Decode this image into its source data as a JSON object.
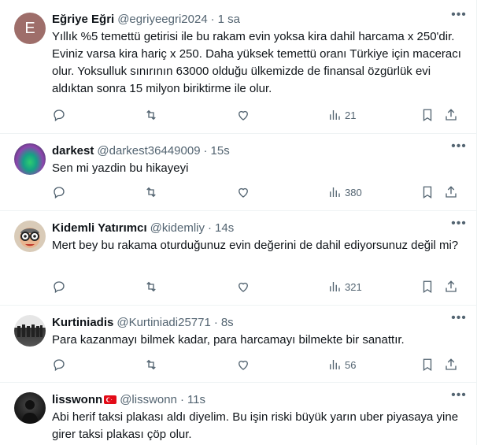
{
  "tweets": [
    {
      "name": "Eğriye Eğri",
      "handle": "@egriyeegri2024",
      "time": "1 sa",
      "avatar_letter": "E",
      "text": "Yıllık %5 temettü getirisi ile bu rakam evin yoksa kira dahil harcama x 250'dir. Eviniz varsa kira hariç x 250. Daha yüksek temettü oranı Türkiye için maceracı olur. Yoksulluk sınırının 63000 olduğu ülkemizde de finansal özgürlük evi aldıktan sonra 15 milyon biriktirme ile olur.",
      "views": "21"
    },
    {
      "name": "darkest",
      "handle": "@darkest36449009",
      "time": "15s",
      "text": "Sen mi yazdin bu hikayeyi",
      "views": "380"
    },
    {
      "name": "Kidemli Yatırımcı",
      "handle": "@kidemliy",
      "time": "14s",
      "text": "Mert bey bu rakama oturduğunuz evin değerini de dahil ediyorsunuz değil mi?",
      "views": "321"
    },
    {
      "name": "Kurtiniadis",
      "handle": "@Kurtiniadi25771",
      "time": "8s",
      "text": "Para kazanmayı bilmek kadar, para harcamayı bilmekte bir sanattır.",
      "views": "56"
    },
    {
      "name": "lisswonn",
      "handle": "@lisswonn",
      "time": "11s",
      "text": "Abi herif taksi plakası aldı diyelim. Bu işin riski büyük yarın uber piyasaya yine girer taksi plakası çöp olur.",
      "views": ""
    }
  ],
  "dot": "·",
  "more_glyph": "•••",
  "colors": {
    "text": "#0f1419",
    "secondary": "#536471",
    "border": "#eff3f4",
    "avatar_e": "#9e6e6a"
  }
}
